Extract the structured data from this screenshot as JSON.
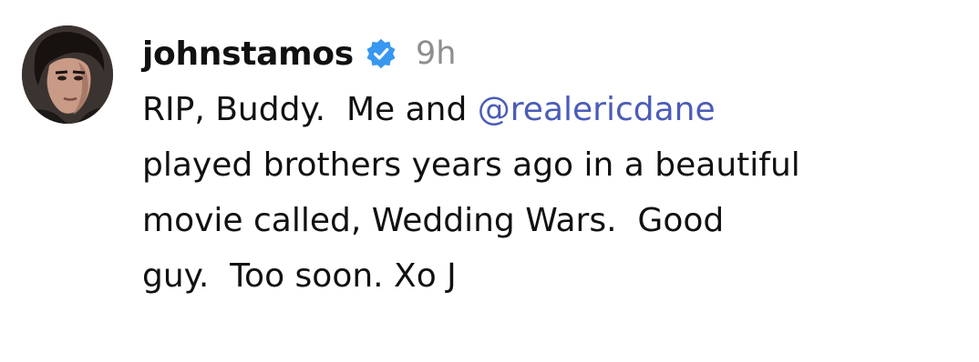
{
  "comment": {
    "username": "johnstamos",
    "timestamp": "9h",
    "verified_icon": "verified-badge-icon",
    "accent_color": "#3897f0",
    "mention_color": "#4b5cb8",
    "text": {
      "line1_before_mention": "RIP, Buddy.  Me and ",
      "mention": "@realericdane",
      "line2": "played brothers years ago in a beautiful",
      "line3": "movie called, Wedding Wars.  Good",
      "line4": "guy.  Too soon. Xo J"
    }
  }
}
